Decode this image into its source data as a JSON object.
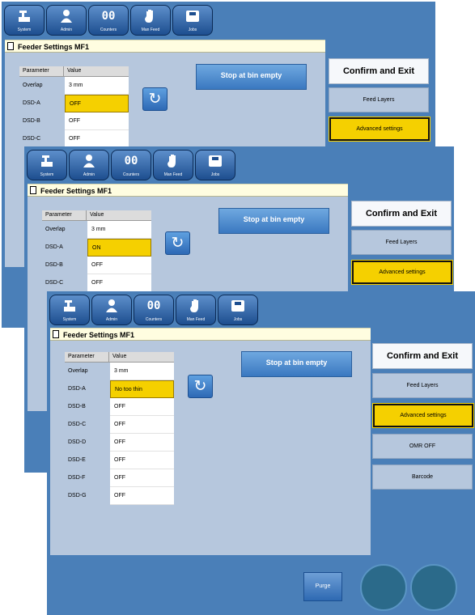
{
  "toolbar": {
    "system": "System",
    "admin": "Admin",
    "counters": "Counters",
    "man_feed": "Man Feed",
    "jobs": "Jobs"
  },
  "title": "Feeder Settings MF1",
  "table": {
    "col_parameter": "Parameter",
    "col_value": "Value",
    "rows": [
      {
        "name": "Overlap",
        "value": "3 mm"
      },
      {
        "name": "DSD-A",
        "value": "No too thin"
      },
      {
        "name": "DSD-B",
        "value": "OFF"
      },
      {
        "name": "DSD-C",
        "value": "OFF"
      },
      {
        "name": "DSD-D",
        "value": "OFF"
      },
      {
        "name": "DSD-E",
        "value": "OFF"
      },
      {
        "name": "DSD-F",
        "value": "OFF"
      },
      {
        "name": "DSD-G",
        "value": "OFF"
      }
    ]
  },
  "screen1": {
    "dsd_a_value": "OFF"
  },
  "screen2": {
    "dsd_a_value": "ON"
  },
  "stop_button": "Stop at bin empty",
  "right_panel": {
    "confirm": "Confirm and Exit",
    "feed_layers": "Feed Layers",
    "advanced": "Advanced settings",
    "omr": "OMR OFF",
    "barcode": "Barcode"
  },
  "purge": "Purge",
  "colors": {
    "panel_blue": "#4a7fb8",
    "content_bg": "#b6c7dd",
    "selected_yellow": "#f5d000",
    "title_bar": "#fffde0"
  }
}
